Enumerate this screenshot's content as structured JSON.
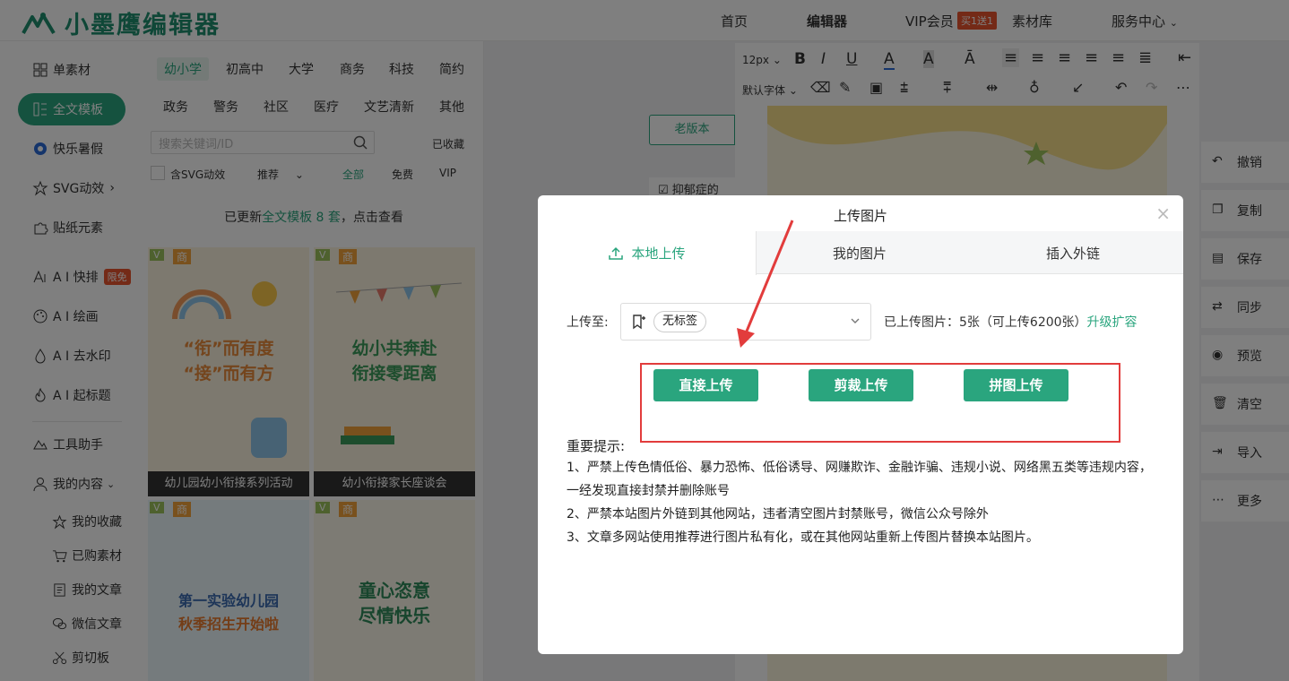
{
  "brand": {
    "name": "小墨鹰编辑器",
    "color": "#1e8e6e",
    "accent": "#2aa57e",
    "warn": "#e8542e"
  },
  "topnav": {
    "home": "首页",
    "editor": "编辑器",
    "vip": "VIP会员",
    "vip_badge": "买1送1",
    "materials": "素材库",
    "service": "服务中心"
  },
  "leftnav": {
    "single": "单素材",
    "fulltext": "全文模板",
    "summer": "快乐暑假",
    "svg": "SVG动效",
    "stickers": "贴纸元素",
    "ai_layout": "A I 快排",
    "limit_free": "限免",
    "ai_draw": "A I 绘画",
    "ai_watermark": "A I 去水印",
    "ai_title": "A I 起标题",
    "tools": "工具助手",
    "mine": "我的内容",
    "sub": {
      "fav": "我的收藏",
      "bought": "已购素材",
      "articles": "我的文章",
      "wechat": "微信文章",
      "clipboard": "剪切板"
    }
  },
  "templates": {
    "cats_row1": [
      "幼小学",
      "初高中",
      "大学",
      "商务",
      "科技",
      "简约"
    ],
    "cats_row2": [
      "政务",
      "警务",
      "社区",
      "医疗",
      "文艺清新",
      "其他"
    ],
    "search_placeholder": "搜索关键词/ID",
    "collected": "已收藏",
    "svg_filter": "含SVG动效",
    "recommend": "推荐",
    "all": "全部",
    "free": "免费",
    "vip": "VIP",
    "banner_pre": "已更新",
    "banner_hl": "全文模板 8 套",
    "banner_post": "，点击查看",
    "thumb_tags": {
      "v": "V",
      "shang": "商"
    },
    "cards": [
      {
        "title1": "“衔”而有度",
        "title2": "“接”而有方",
        "caption": "幼儿园幼小衔接系列活动"
      },
      {
        "title1": "幼小共奔赴",
        "title2": "衔接零距离",
        "caption": "幼小衔接家长座谈会"
      },
      {
        "title1": "第一实验幼儿园",
        "title2": "秋季招生开始啦",
        "caption": ""
      },
      {
        "title1": "童心恣意",
        "title2": "尽情快乐",
        "caption": ""
      }
    ]
  },
  "editor": {
    "font_size": "12px",
    "default_font": "默认字体",
    "old_version": "老版本",
    "doc_fragment": "抑郁症的",
    "side_actions": [
      "撤销",
      "复制",
      "保存",
      "同步",
      "预览",
      "清空",
      "导入",
      "更多"
    ]
  },
  "modal": {
    "title": "上传图片",
    "tabs": [
      "本地上传",
      "我的图片",
      "插入外链"
    ],
    "upload_to_label": "上传至:",
    "tag_chip": "无标签",
    "quota_text": "已上传图片：5张（可上传6200张）",
    "upgrade": "升级扩容",
    "buttons": [
      "直接上传",
      "剪裁上传",
      "拼图上传"
    ],
    "notice_title": "重要提示:",
    "notice_lines": [
      "1、严禁上传色情低俗、暴力恐怖、低俗诱导、网赚欺诈、金融诈骗、违规小说、网络黑五类等违规内容，一经发现直接封禁并删除账号",
      "2、严禁本站图片外链到其他网站，违者清空图片封禁账号，微信公众号除外",
      "3、文章多网站使用推荐进行图片私有化，或在其他网站重新上传图片替换本站图片。"
    ]
  }
}
